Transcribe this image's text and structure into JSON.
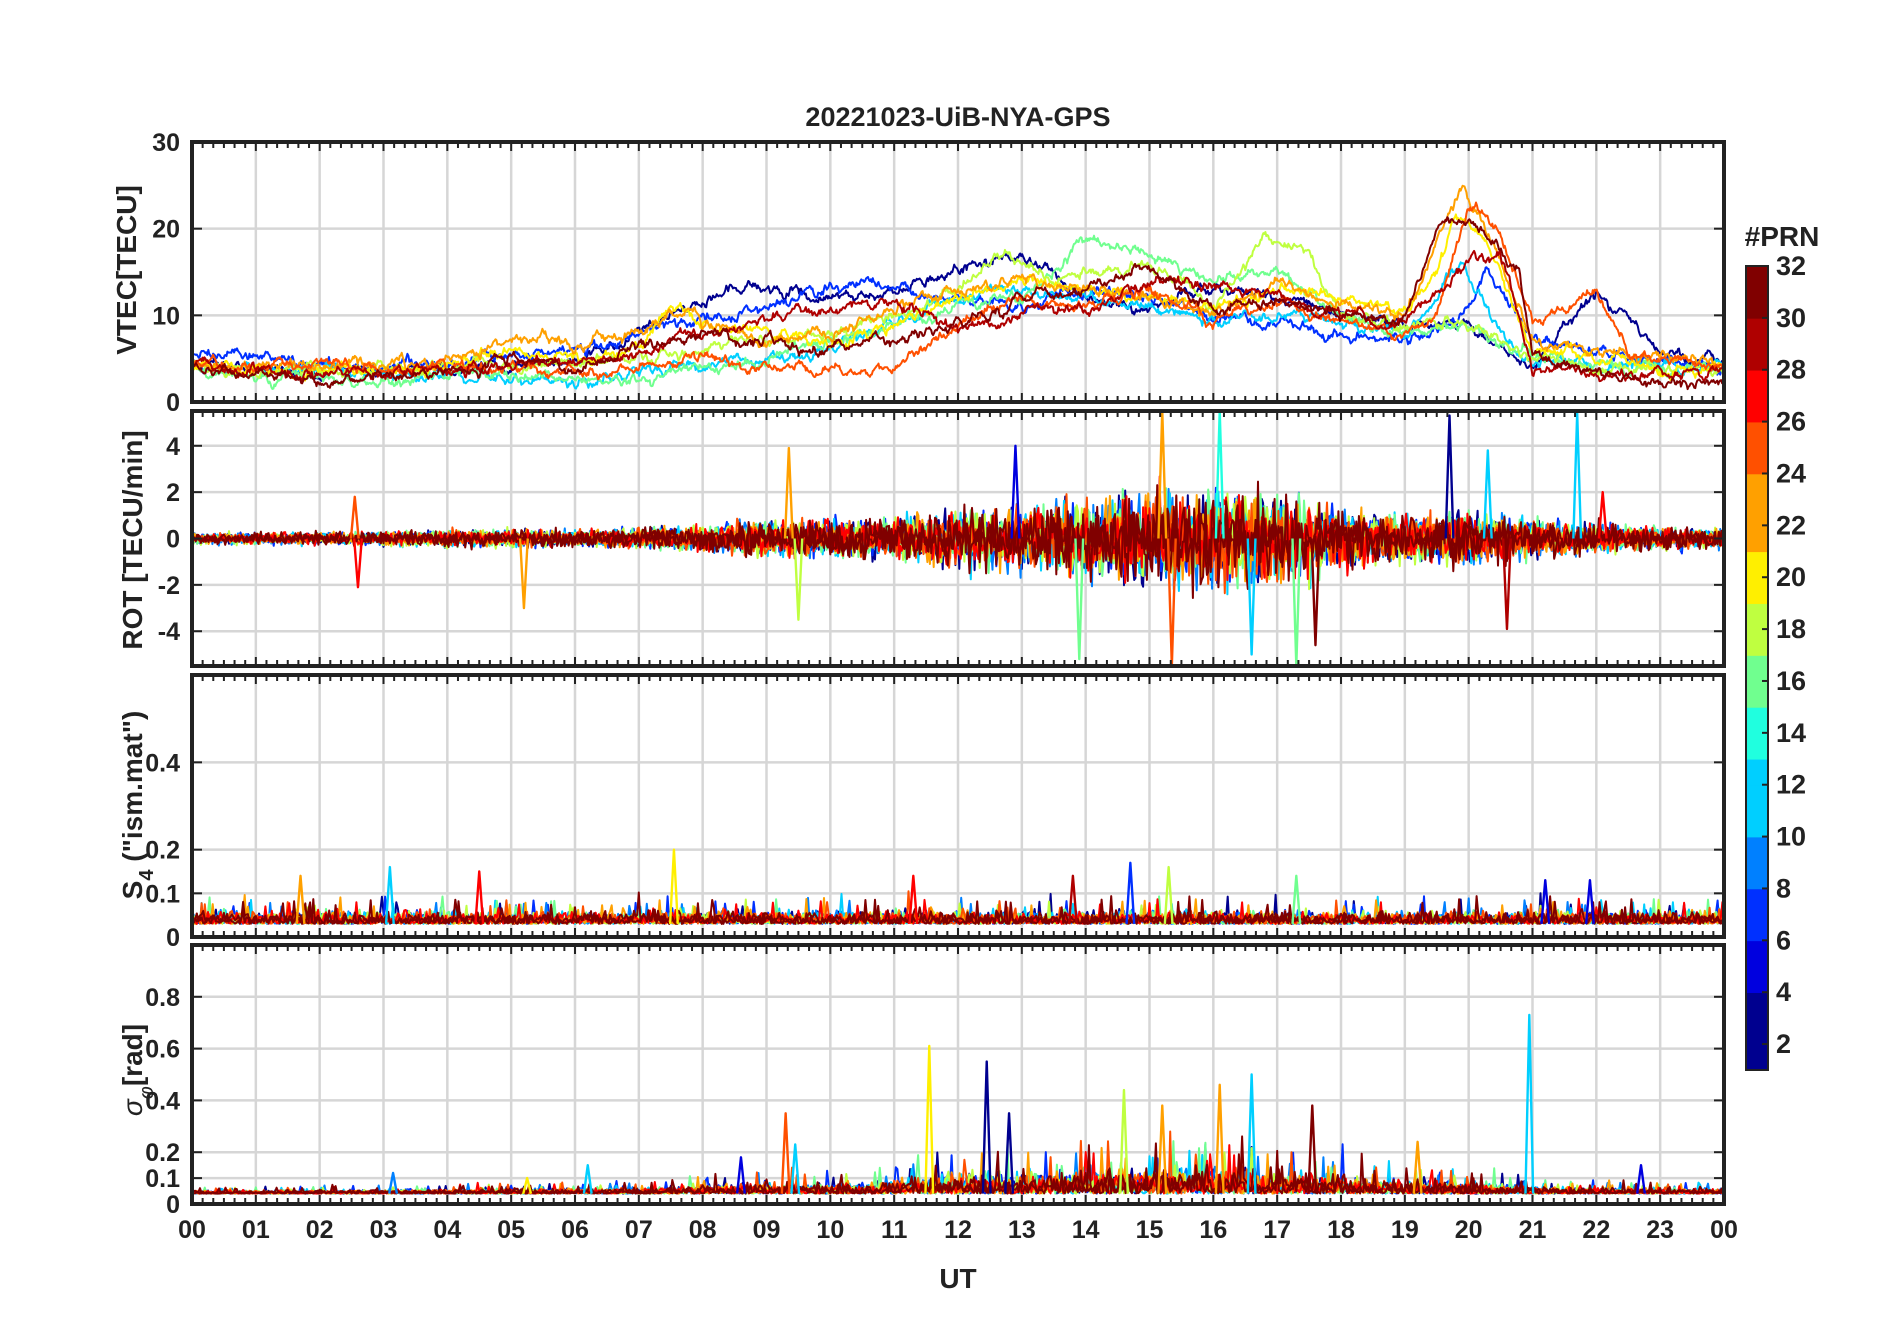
{
  "figure": {
    "title": "20221023-UiB-NYA-GPS",
    "xlabel": "UT",
    "x_tick_labels": [
      "00",
      "01",
      "02",
      "03",
      "04",
      "05",
      "06",
      "07",
      "08",
      "09",
      "10",
      "11",
      "12",
      "13",
      "14",
      "15",
      "16",
      "17",
      "18",
      "19",
      "20",
      "21",
      "22",
      "23",
      "00"
    ],
    "colorbar": {
      "title": "#PRN",
      "ticks": [
        2,
        4,
        6,
        8,
        10,
        12,
        14,
        16,
        18,
        20,
        22,
        24,
        26,
        28,
        30,
        32
      ],
      "range": [
        1,
        32
      ],
      "colormap": "jet",
      "colors": [
        "#00008F",
        "#0000DF",
        "#0030FF",
        "#0080FF",
        "#00CFFF",
        "#20FFDF",
        "#70FF8F",
        "#BFFF40",
        "#FFEF00",
        "#FFA000",
        "#FF5000",
        "#FF0000",
        "#AF0000",
        "#800000"
      ]
    }
  },
  "chart_data": [
    {
      "type": "line",
      "panel": "VTEC",
      "ylabel": "VTEC[TECU]",
      "xlim": [
        0,
        24
      ],
      "ylim": [
        0,
        30
      ],
      "y_ticks": [
        0,
        10,
        20,
        30
      ],
      "x_unit": "hours UT",
      "series": [
        {
          "prn": 3,
          "x": [
            0,
            2,
            4,
            6,
            7,
            8,
            8.8,
            10,
            11,
            12,
            13,
            14,
            15,
            16,
            17,
            18,
            19,
            20,
            21,
            22,
            23,
            24
          ],
          "y": [
            4.5,
            3.5,
            4,
            5,
            8,
            12,
            13.5,
            12,
            13,
            15,
            17,
            12,
            11,
            13,
            12,
            10,
            9,
            9,
            4,
            13,
            6,
            5
          ]
        },
        {
          "prn": 7,
          "x": [
            0,
            2,
            4,
            6,
            7,
            8,
            9,
            10,
            10.5,
            11,
            12,
            13,
            14,
            15,
            16,
            17,
            18,
            19,
            19.8,
            20.3,
            21,
            22,
            23,
            24
          ],
          "y": [
            5.5,
            4.5,
            4.2,
            6,
            7.5,
            10,
            11,
            13,
            14,
            13,
            12,
            11,
            13,
            12,
            10,
            9,
            8,
            7,
            9,
            15,
            7,
            6,
            4.5,
            4
          ]
        },
        {
          "prn": 11,
          "x": [
            0,
            2,
            4,
            5,
            6,
            7,
            8,
            9,
            10,
            11,
            12,
            13,
            14,
            15,
            16,
            17,
            18,
            19,
            19.9,
            20.5,
            21,
            22,
            23,
            24
          ],
          "y": [
            4,
            3.5,
            3,
            2.5,
            2.5,
            3.5,
            4,
            5,
            6,
            9,
            12,
            13,
            12,
            11,
            9,
            10,
            9,
            8,
            16,
            8,
            5,
            4,
            4,
            4
          ]
        },
        {
          "prn": 15,
          "x": [
            0,
            1,
            2,
            3,
            4,
            5,
            6,
            7,
            8,
            9,
            10,
            11,
            12,
            13,
            14,
            15,
            16,
            17,
            18,
            19,
            20,
            21,
            22,
            23,
            24
          ],
          "y": [
            3.5,
            3,
            2.5,
            2.5,
            3.5,
            3,
            2.5,
            2.5,
            4,
            5,
            7,
            9,
            11,
            12,
            19,
            17,
            14,
            15,
            10,
            8,
            9,
            5,
            4,
            4,
            3.5
          ]
        },
        {
          "prn": 17,
          "x": [
            0,
            2,
            4,
            6,
            7,
            8,
            9,
            10,
            11,
            12,
            12.8,
            13.5,
            14,
            15,
            16,
            16.8,
            17.5,
            18,
            19,
            20,
            21,
            22,
            23,
            24
          ],
          "y": [
            4,
            3.5,
            4,
            4.5,
            5,
            6,
            7,
            8,
            10,
            13,
            17,
            14,
            15,
            16,
            11,
            19,
            17,
            10,
            9,
            9,
            5,
            4,
            4,
            3.5
          ]
        },
        {
          "prn": 20,
          "x": [
            0,
            2,
            4,
            5,
            6,
            7,
            7.5,
            8,
            9,
            10,
            11,
            12,
            13,
            14,
            15,
            16,
            17,
            18,
            19,
            19.5,
            19.8,
            20.3,
            21,
            22,
            23,
            24
          ],
          "y": [
            4,
            3.5,
            4,
            6,
            5,
            6,
            11,
            9,
            8,
            7,
            9,
            12,
            14,
            13,
            12,
            11,
            13,
            12,
            11,
            15,
            22,
            18,
            6,
            5,
            4,
            4
          ]
        },
        {
          "prn": 22,
          "x": [
            0,
            2,
            4,
            5,
            5.5,
            6,
            7,
            7.8,
            8,
            9,
            10,
            11,
            12,
            13,
            14,
            15,
            16,
            17,
            18,
            19,
            19.9,
            20.4,
            21,
            22,
            23,
            24
          ],
          "y": [
            4.5,
            4,
            5,
            7,
            8,
            6,
            8,
            11,
            9,
            7,
            8,
            11,
            13,
            14,
            13,
            12,
            10,
            14,
            11,
            10,
            25,
            18,
            7,
            6,
            5,
            4.5
          ]
        },
        {
          "prn": 25,
          "x": [
            0,
            1,
            2,
            3,
            4,
            5,
            6,
            7,
            8,
            9,
            9.5,
            10,
            11,
            12,
            13,
            14,
            15,
            16,
            17,
            18,
            19,
            19.5,
            20,
            20.5,
            21,
            22,
            22.5,
            23,
            24
          ],
          "y": [
            4.5,
            4,
            4.5,
            3.5,
            4,
            4,
            3.5,
            4,
            5,
            4,
            4,
            3.5,
            4,
            9,
            12,
            11,
            13,
            10,
            11,
            9,
            8,
            10,
            23,
            20,
            9,
            13,
            6,
            5,
            4
          ]
        },
        {
          "prn": 28,
          "x": [
            0,
            1,
            2,
            3,
            4,
            5,
            6,
            7,
            8,
            9,
            10,
            11,
            12,
            13,
            14,
            15,
            16,
            17,
            18,
            19,
            20,
            20.5,
            21,
            22,
            23,
            24
          ],
          "y": [
            4,
            3.5,
            3,
            3.5,
            3.5,
            4.5,
            4.5,
            5.5,
            8,
            9,
            11,
            12,
            8,
            10,
            11,
            14,
            13,
            12,
            10,
            9,
            16,
            17,
            4,
            3,
            3,
            3.5
          ]
        },
        {
          "prn": 31,
          "x": [
            0,
            1,
            2,
            3,
            4,
            5,
            6,
            7,
            8,
            9,
            10,
            11,
            12,
            13,
            14,
            15,
            16,
            17,
            18,
            19,
            19.5,
            20,
            20.5,
            20.8,
            21,
            22,
            23,
            24
          ],
          "y": [
            4,
            3,
            2.5,
            3,
            3.5,
            5,
            4,
            6,
            8,
            7,
            6,
            7,
            9,
            12,
            13,
            15,
            11,
            12,
            10,
            9,
            20,
            21,
            17,
            15,
            5,
            3,
            2,
            2
          ]
        }
      ]
    },
    {
      "type": "line",
      "panel": "ROT",
      "ylabel": "ROT [TECU/min]",
      "xlim": [
        0,
        24
      ],
      "ylim": [
        -5.5,
        5.5
      ],
      "y_ticks": [
        -4,
        -2,
        0,
        2,
        4
      ],
      "x_unit": "hours UT",
      "envelope": {
        "x": [
          0,
          2,
          4,
          6,
          7,
          8,
          9,
          10,
          11,
          12,
          13,
          14,
          15,
          16,
          17,
          18,
          19,
          20,
          21,
          22,
          23,
          24
        ],
        "amplitude": [
          0.4,
          0.4,
          0.6,
          0.6,
          0.7,
          1.0,
          1.2,
          1.3,
          1.4,
          2.0,
          2.2,
          2.6,
          3.2,
          3.4,
          3.0,
          2.0,
          1.6,
          1.8,
          1.3,
          1.0,
          0.8,
          0.7
        ]
      },
      "spikes": [
        {
          "x": 2.6,
          "y": -2.1,
          "prn": 26
        },
        {
          "x": 2.55,
          "y": 1.8,
          "prn": 25
        },
        {
          "x": 5.2,
          "y": -3.0,
          "prn": 23
        },
        {
          "x": 9.35,
          "y": 3.9,
          "prn": 21
        },
        {
          "x": 9.5,
          "y": -3.5,
          "prn": 18
        },
        {
          "x": 12.9,
          "y": 4.0,
          "prn": 4
        },
        {
          "x": 13.9,
          "y": -5.2,
          "prn": 16
        },
        {
          "x": 15.2,
          "y": 5.5,
          "prn": 22
        },
        {
          "x": 15.35,
          "y": -5.5,
          "prn": 24
        },
        {
          "x": 16.1,
          "y": 5.5,
          "prn": 13
        },
        {
          "x": 16.6,
          "y": -5.0,
          "prn": 12
        },
        {
          "x": 17.3,
          "y": -5.5,
          "prn": 15
        },
        {
          "x": 17.6,
          "y": -4.6,
          "prn": 31
        },
        {
          "x": 19.7,
          "y": 5.3,
          "prn": 3
        },
        {
          "x": 20.3,
          "y": 3.8,
          "prn": 10
        },
        {
          "x": 20.6,
          "y": -3.9,
          "prn": 29
        },
        {
          "x": 21.7,
          "y": 5.4,
          "prn": 12
        },
        {
          "x": 22.1,
          "y": 2.0,
          "prn": 27
        }
      ]
    },
    {
      "type": "line",
      "panel": "S4",
      "ylabel": "S4 (\"ism.mat\")",
      "ylabel_parts": {
        "main": "S",
        "sub": "4",
        "rest": " (\"ism.mat\")"
      },
      "xlim": [
        0,
        24
      ],
      "ylim": [
        0,
        0.6
      ],
      "y_ticks": [
        0,
        0.1,
        0.2,
        0.4
      ],
      "x_unit": "hours UT",
      "baseline": 0.03,
      "noise": 0.04,
      "spikes": [
        {
          "x": 1.7,
          "y": 0.14,
          "prn": 22
        },
        {
          "x": 3.1,
          "y": 0.16,
          "prn": 10
        },
        {
          "x": 4.5,
          "y": 0.15,
          "prn": 27
        },
        {
          "x": 7.55,
          "y": 0.2,
          "prn": 20
        },
        {
          "x": 11.3,
          "y": 0.14,
          "prn": 26
        },
        {
          "x": 13.8,
          "y": 0.14,
          "prn": 28
        },
        {
          "x": 14.7,
          "y": 0.17,
          "prn": 7
        },
        {
          "x": 15.3,
          "y": 0.16,
          "prn": 17
        },
        {
          "x": 17.3,
          "y": 0.14,
          "prn": 15
        },
        {
          "x": 21.2,
          "y": 0.13,
          "prn": 5
        },
        {
          "x": 21.9,
          "y": 0.13,
          "prn": 4
        }
      ]
    },
    {
      "type": "line",
      "panel": "sigma_phi",
      "ylabel": "σφ[rad]",
      "ylabel_parts": {
        "main": "σ",
        "sub": "φ",
        "rest": "[rad]"
      },
      "xlim": [
        0,
        24
      ],
      "ylim": [
        0,
        1
      ],
      "y_ticks": [
        0,
        0.1,
        0.2,
        0.4,
        0.6,
        0.8
      ],
      "x_unit": "hours UT",
      "baseline": 0.04,
      "envelope": {
        "x": [
          0,
          4,
          7,
          8,
          9,
          11,
          12,
          13,
          14,
          15,
          16,
          17,
          18,
          19,
          20,
          21,
          22,
          23,
          24
        ],
        "amplitude": [
          0.02,
          0.03,
          0.04,
          0.06,
          0.07,
          0.08,
          0.15,
          0.14,
          0.16,
          0.2,
          0.2,
          0.15,
          0.13,
          0.1,
          0.08,
          0.05,
          0.04,
          0.04,
          0.04
        ]
      },
      "spikes": [
        {
          "x": 3.15,
          "y": 0.12,
          "prn": 8
        },
        {
          "x": 5.25,
          "y": 0.1,
          "prn": 20
        },
        {
          "x": 6.2,
          "y": 0.15,
          "prn": 11
        },
        {
          "x": 8.6,
          "y": 0.18,
          "prn": 5
        },
        {
          "x": 9.3,
          "y": 0.35,
          "prn": 24
        },
        {
          "x": 9.45,
          "y": 0.23,
          "prn": 12
        },
        {
          "x": 11.55,
          "y": 0.61,
          "prn": 20
        },
        {
          "x": 12.45,
          "y": 0.55,
          "prn": 3
        },
        {
          "x": 12.8,
          "y": 0.35,
          "prn": 2
        },
        {
          "x": 14.6,
          "y": 0.44,
          "prn": 17
        },
        {
          "x": 15.2,
          "y": 0.38,
          "prn": 22
        },
        {
          "x": 16.1,
          "y": 0.46,
          "prn": 23
        },
        {
          "x": 16.6,
          "y": 0.5,
          "prn": 12
        },
        {
          "x": 17.55,
          "y": 0.38,
          "prn": 31
        },
        {
          "x": 19.2,
          "y": 0.24,
          "prn": 21
        },
        {
          "x": 20.95,
          "y": 0.73,
          "prn": 12
        },
        {
          "x": 22.7,
          "y": 0.15,
          "prn": 4
        }
      ]
    }
  ]
}
